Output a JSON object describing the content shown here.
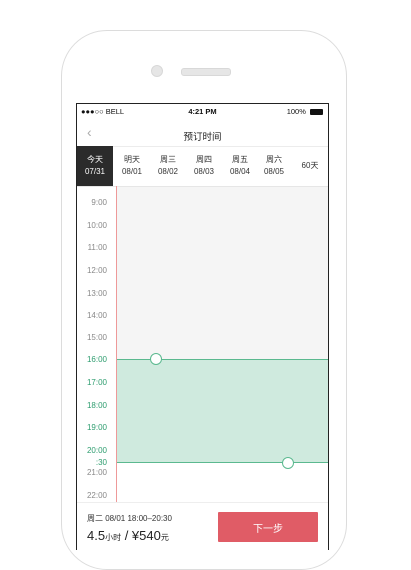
{
  "status_bar": {
    "carrier": "●●●○○ BELL",
    "time": "4:21 PM",
    "battery": "100%"
  },
  "nav": {
    "back_icon": "chevron-left-icon",
    "title": "预订时间"
  },
  "days": [
    {
      "weekday": "今天",
      "date": "07/31",
      "active": true
    },
    {
      "weekday": "明天",
      "date": "08/01"
    },
    {
      "weekday": "周三",
      "date": "08/02"
    },
    {
      "weekday": "周四",
      "date": "08/03"
    },
    {
      "weekday": "周五",
      "date": "08/04"
    },
    {
      "weekday": "周六",
      "date": "08/05"
    },
    {
      "weekday": "60天",
      "date": ""
    }
  ],
  "hours": [
    "9:00",
    "10:00",
    "11:00",
    "12:00",
    "13:00",
    "14:00",
    "15:00",
    "16:00",
    "17:00",
    "18:00",
    "19:00",
    "20:00",
    ":30",
    "21:00",
    "22:00"
  ],
  "selection": {
    "start": "16:00",
    "end": "20:30"
  },
  "footer": {
    "summary": "周二 08/01  18:00–20:30",
    "hours_value": "4.5",
    "hours_unit": "小时",
    "separator": " / ¥",
    "price_value": "540",
    "price_unit": "元",
    "next_label": "下一步"
  },
  "colors": {
    "accent": "#e05c66",
    "selection": "#5bb98f",
    "active_day": "#2b2b2b"
  }
}
